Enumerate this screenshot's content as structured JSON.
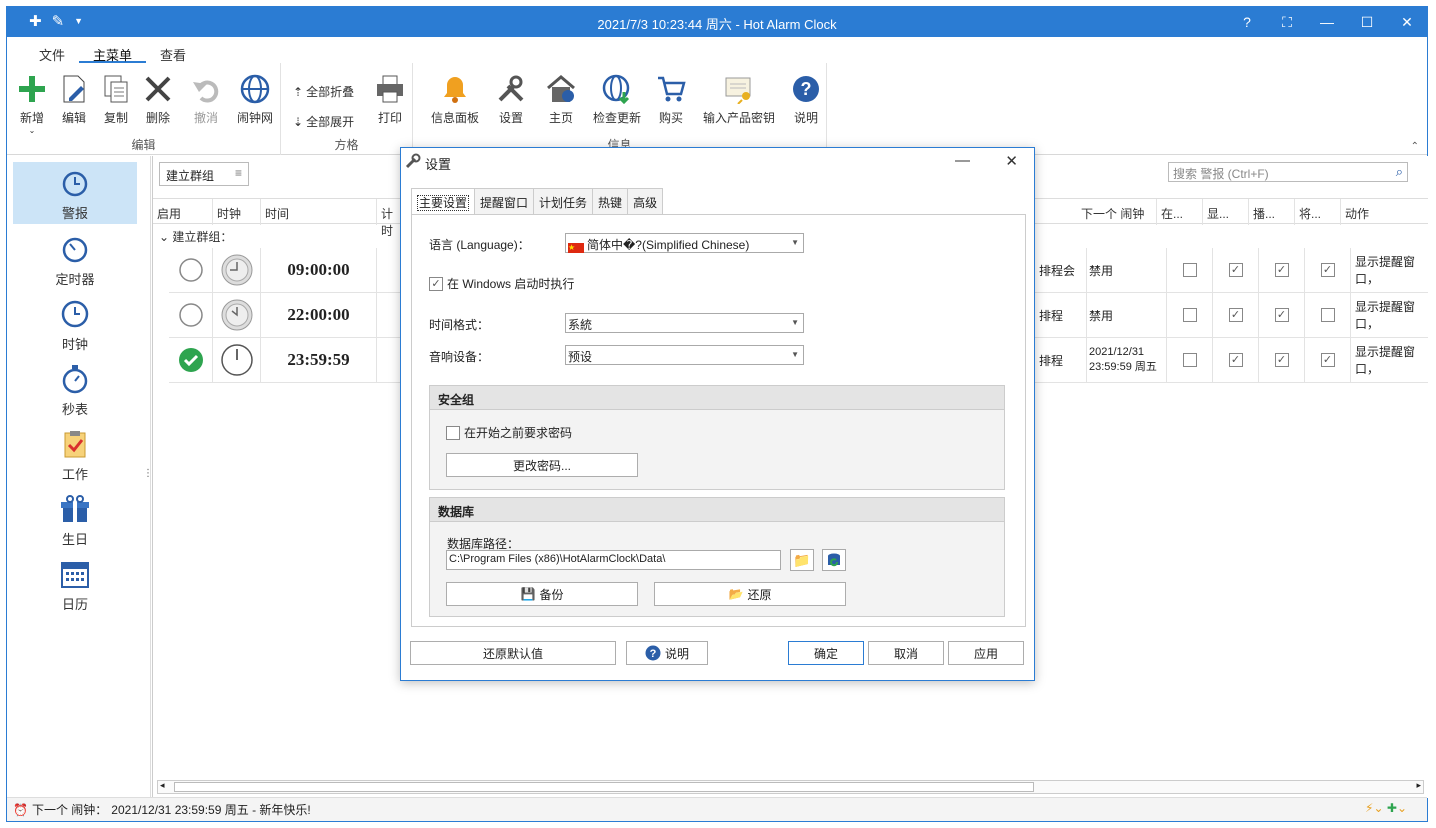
{
  "window": {
    "title": "2021/7/3 10:23:44 周六 - Hot Alarm Clock"
  },
  "menu": {
    "tabs": [
      "文件",
      "主菜单",
      "查看"
    ]
  },
  "ribbon": {
    "edit": {
      "group": "编辑",
      "new": "新增",
      "edit": "编辑",
      "copy": "复制",
      "delete": "删除",
      "undo": "撤消",
      "web": "闹钟网"
    },
    "view": {
      "group": "方格",
      "collapse": "全部折叠",
      "expand": "全部展开",
      "print": "打印"
    },
    "info": {
      "group": "信息",
      "panel": "信息面板",
      "settings": "设置",
      "home": "主页",
      "update": "检查更新",
      "buy": "购买",
      "key": "输入产品密钥",
      "help": "说明"
    }
  },
  "sidebar": {
    "items": [
      "警报",
      "定时器",
      "时钟",
      "秒表",
      "工作",
      "生日",
      "日历"
    ]
  },
  "grid": {
    "group_button": "建立群组",
    "search_placeholder": "搜索 警报 (Ctrl+F)",
    "headers": {
      "enable": "启用",
      "clock": "时钟",
      "time": "时间",
      "plan": "计时",
      "next": "下一个 闹钟",
      "c1": "在...",
      "c2": "显...",
      "c3": "播...",
      "c4": "将...",
      "action": "动作"
    },
    "group_label": "建立群组：",
    "rows": [
      {
        "time": "09:00:00",
        "schedule": "排程会",
        "next": "禁用",
        "action": "显示提醒窗口，"
      },
      {
        "time": "22:00:00",
        "schedule": "排程",
        "next": "禁用",
        "action": "显示提醒窗口，"
      },
      {
        "time": "23:59:59",
        "schedule": "排程",
        "next": "2021/12/31\n23:59:59 周五",
        "action": "显示提醒窗口，"
      }
    ]
  },
  "status": {
    "label": "下一个 闹钟：",
    "value": "2021/12/31 23:59:59 周五 - 新年快乐!"
  },
  "dialog": {
    "title": "设置",
    "tabs": [
      "主要设置",
      "提醒窗口",
      "计划任务",
      "热键",
      "高级"
    ],
    "language_label": "语言 (Language)：",
    "language_value": "简体中�?(Simplified Chinese)",
    "startup_label": "在 Windows 启动时执行",
    "time_format_label": "时间格式：",
    "time_format_value": "系統",
    "audio_label": "音响设备：",
    "audio_value": "预设",
    "security": {
      "title": "安全组",
      "require_password": "在开始之前要求密码",
      "change_password": "更改密码..."
    },
    "database": {
      "title": "数据库",
      "path_label": "数据库路径：",
      "path_value": "C:\\Program Files (x86)\\HotAlarmClock\\Data\\",
      "backup": "备份",
      "restore": "还原"
    },
    "buttons": {
      "defaults": "还原默认值",
      "help": "说明",
      "ok": "确定",
      "cancel": "取消",
      "apply": "应用"
    }
  },
  "colors": {
    "accent": "#2b7cd3",
    "sidebar_active": "#cce4f7",
    "green": "#2ea44f"
  }
}
